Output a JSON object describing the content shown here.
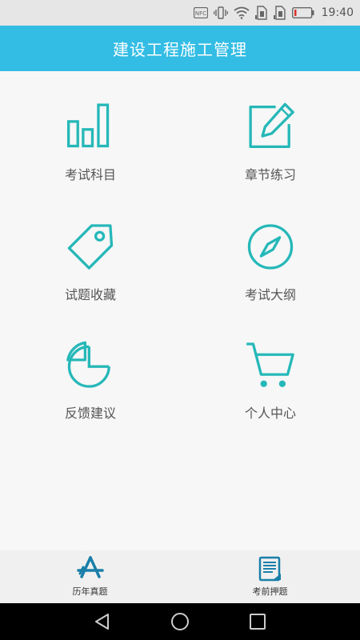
{
  "status_bar": {
    "time": "19:40",
    "icons": [
      "nfc-icon",
      "vibrate-icon",
      "wifi-icon",
      "sim-card-1-icon",
      "sim-card-2-icon",
      "battery-low-icon"
    ]
  },
  "header": {
    "title": "建设工程施工管理"
  },
  "grid": {
    "items": [
      {
        "label": "考试科目",
        "icon": "bar-chart-icon"
      },
      {
        "label": "章节练习",
        "icon": "edit-icon"
      },
      {
        "label": "试题收藏",
        "icon": "tag-icon"
      },
      {
        "label": "考试大纲",
        "icon": "compass-icon"
      },
      {
        "label": "反馈建议",
        "icon": "pie-chart-icon"
      },
      {
        "label": "个人中心",
        "icon": "shopping-cart-icon"
      }
    ]
  },
  "tabs": [
    {
      "label": "历年真题",
      "icon": "app-store-icon"
    },
    {
      "label": "考前押题",
      "icon": "document-icon"
    }
  ],
  "nav_bar": {
    "buttons": [
      "back-icon",
      "home-icon",
      "recents-icon"
    ]
  },
  "colors": {
    "accent": "#33bde5",
    "icon_teal": "#26b8b8",
    "tab_icon_blue": "#1a7fa8"
  }
}
